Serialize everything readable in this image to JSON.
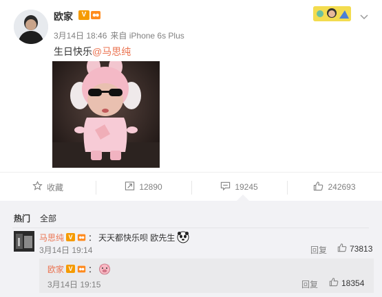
{
  "post": {
    "author": "欧家",
    "v_badge": "V",
    "date": "3月14日 18:46",
    "source": "来自 iPhone 6s Plus",
    "text_prefix": "生日快乐",
    "mention": "@马思纯",
    "icons": {
      "verified": "verified-v-icon",
      "level": "level-badge-icon",
      "menu": "chevron-down-icon"
    }
  },
  "actions": {
    "favorite": {
      "label": "收藏",
      "icon": "star-icon"
    },
    "repost": {
      "count": "12890",
      "icon": "repost-icon"
    },
    "comment": {
      "count": "19245",
      "icon": "comment-icon"
    },
    "like": {
      "count": "242693",
      "icon": "thumbs-up-icon"
    }
  },
  "comments": {
    "tabs": [
      "热门",
      "全部"
    ],
    "items": [
      {
        "name": "马思纯",
        "v_badge": "V",
        "separator": "：",
        "text": "天天都快乐呗 欧先生",
        "time": "3月14日 19:14",
        "reply_label": "回复",
        "likes": "73813",
        "emoji": "panda-face-icon",
        "reply": {
          "name": "欧家",
          "v_badge": "V",
          "separator": "：",
          "time": "3月14日 19:15",
          "reply_label": "回复",
          "likes": "18354",
          "emoji": "pig-face-icon"
        }
      }
    ]
  },
  "colors": {
    "accent": "#eb7350",
    "badge_orange": "#f59b00",
    "comment_bg": "#f2f2f5",
    "muted_text": "#808080"
  }
}
